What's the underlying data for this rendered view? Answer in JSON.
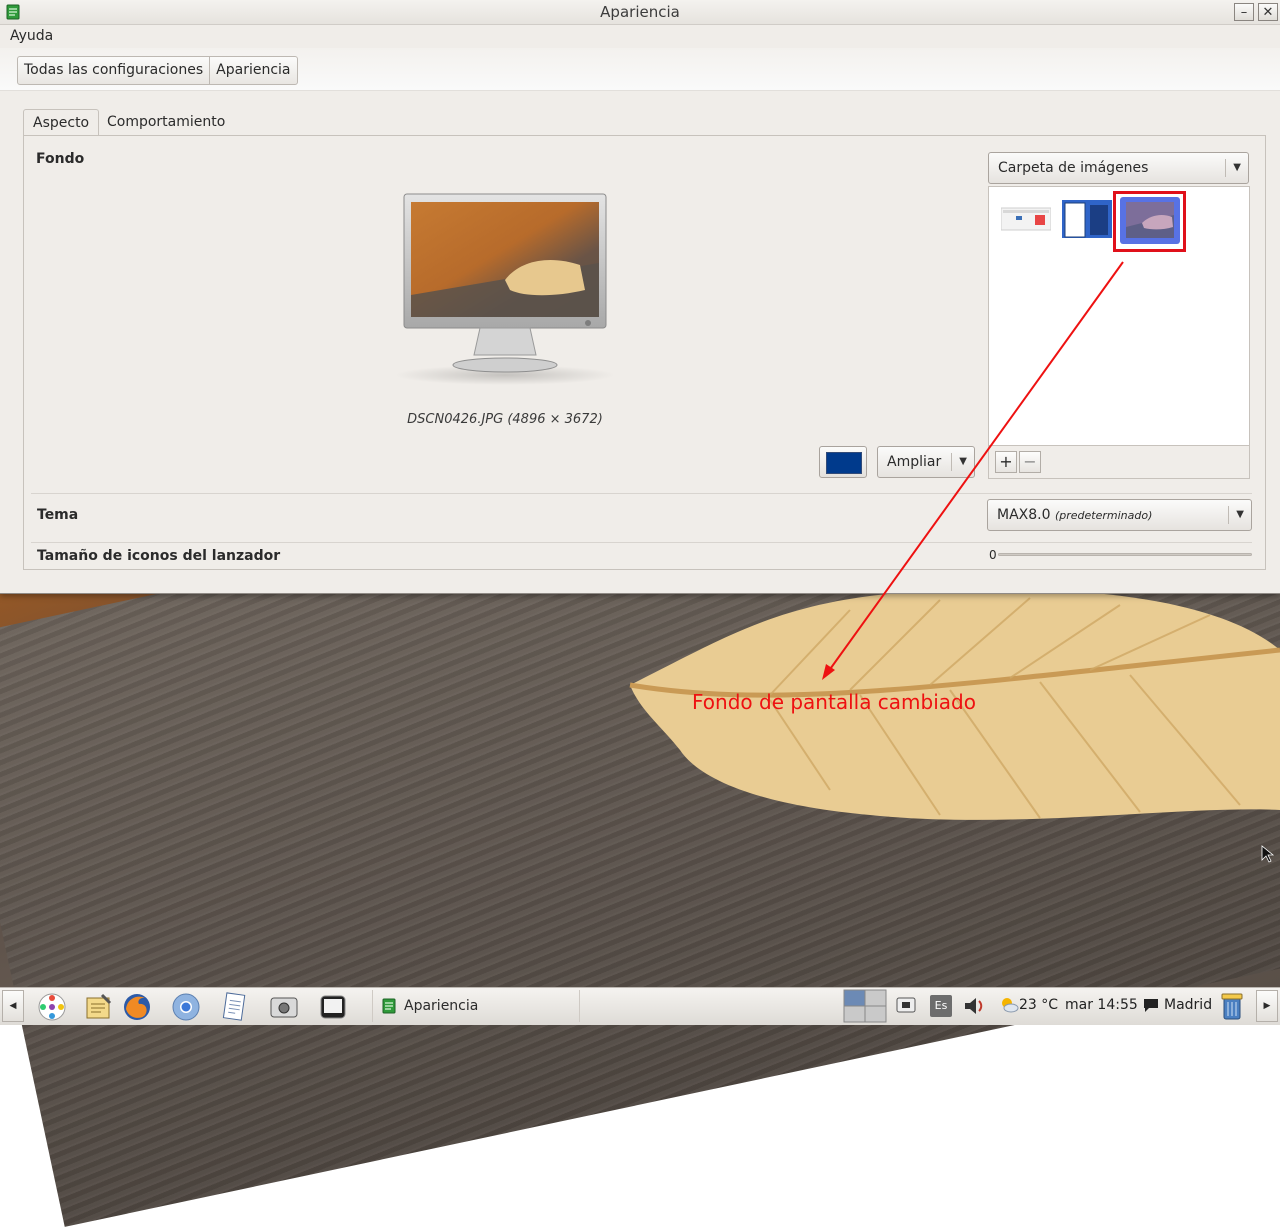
{
  "window": {
    "title": "Apariencia",
    "minimize_label": "–",
    "close_label": "✕"
  },
  "menu": {
    "help": "Ayuda"
  },
  "breadcrumb": [
    "Todas las configuraciones",
    "Apariencia"
  ],
  "tabs": [
    {
      "label": "Aspecto",
      "active": true
    },
    {
      "label": "Comportamiento",
      "active": false
    }
  ],
  "background": {
    "section_label": "Fondo",
    "image_caption": "DSCN0426.JPG (4896 × 3672)",
    "color_swatch": "#003a8c",
    "zoom_combo": "Ampliar",
    "source_combo": "Carpeta de imágenes",
    "add_label": "+",
    "remove_label": "−",
    "thumbnails": [
      "screenshot-thumb-1",
      "screenshot-thumb-2",
      "leaf-wallpaper-thumb"
    ],
    "selected_thumbnail": 2
  },
  "theme": {
    "section_label": "Tema",
    "value": "MAX8.0",
    "value_suffix": "(predeterminado)"
  },
  "launcher_icon_size": {
    "section_label": "Tamaño de iconos del lanzador",
    "value": "0"
  },
  "annotation": {
    "text": "Fondo de pantalla cambiado",
    "color": "#ee1111"
  },
  "taskbar": {
    "scroll_left": "◀",
    "scroll_right": "▶",
    "launchers": [
      "menu-icon",
      "notes-icon",
      "firefox-icon",
      "chromium-icon",
      "text-editor-icon",
      "screenshot-icon",
      "terminal-icon"
    ],
    "task_label": "Apariencia",
    "keyboard_layout": "Es",
    "temperature": "23 °C",
    "clock": "mar 14:55",
    "location": "Madrid"
  }
}
